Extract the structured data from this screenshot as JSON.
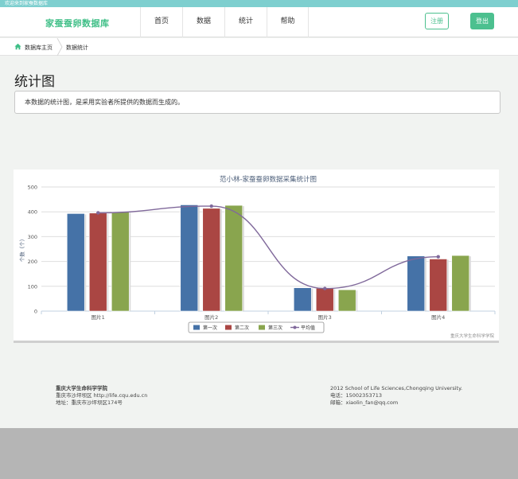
{
  "topbar": {
    "welcome": "欢迎来到家蚕数据库"
  },
  "header": {
    "brand": "家蚕蚕卵数据库",
    "nav": [
      "首页",
      "数据",
      "统计",
      "帮助"
    ],
    "register_label": "注册",
    "login_label": "登出"
  },
  "breadcrumb": {
    "home": "数据库主页",
    "current": "数据统计"
  },
  "main": {
    "title": "统计图",
    "description": "本数据的统计图，是采用实验者所提供的数据而生成的。"
  },
  "chart_data": {
    "type": "bar",
    "title": "范小林-家蚕蚕卵数据采集统计图",
    "categories": [
      "图片1",
      "图片2",
      "图片3",
      "图片4"
    ],
    "series": [
      {
        "name": "第一次",
        "type": "bar",
        "color": "#4572a7",
        "values": [
          393,
          428,
          94,
          222
        ]
      },
      {
        "name": "第二次",
        "type": "bar",
        "color": "#aa4643",
        "values": [
          395,
          414,
          92,
          210
        ]
      },
      {
        "name": "第三次",
        "type": "bar",
        "color": "#89a54e",
        "values": [
          400,
          426,
          86,
          224
        ]
      },
      {
        "name": "平均值",
        "type": "spline",
        "color": "#80699b",
        "values": [
          396,
          423,
          91,
          219
        ]
      }
    ],
    "ylabel": "个数（个）",
    "ylim": [
      0,
      500
    ],
    "yticks": [
      0,
      100,
      200,
      300,
      400,
      500
    ],
    "legend": "bottom-center",
    "grid": true,
    "credit": "重庆大学生命科学学院"
  },
  "footer": {
    "org": "重庆大学生命科学学院",
    "address_line": "重庆市沙坪坝区   http://life.cqu.edu.cn",
    "location_line": "地址：重庆市沙坪坝区174号",
    "copyright": "2012 School of Life Sciences,Chongqing University.",
    "phone": "电话：15002353713",
    "email": "邮箱：xiaolin_fan@qq.com"
  }
}
